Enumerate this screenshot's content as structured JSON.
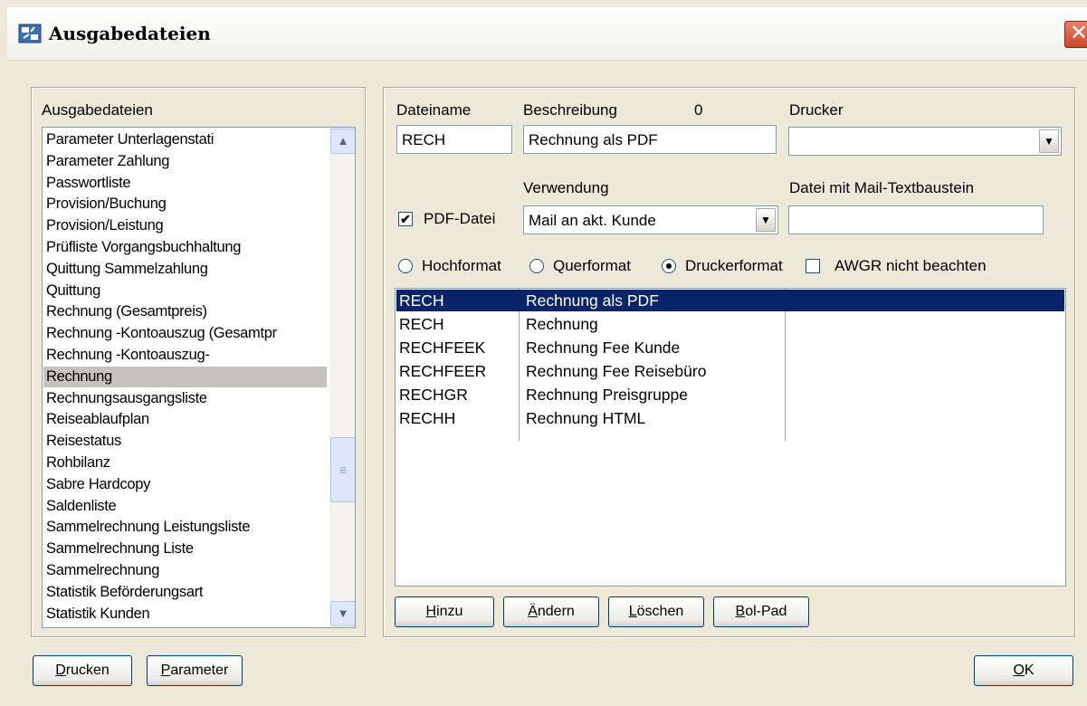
{
  "window": {
    "title": "Ausgabedateien",
    "close_glyph": "✕"
  },
  "left": {
    "label": "Ausgabedateien",
    "items": [
      "Parameter Unterlagenstati",
      "Parameter Zahlung",
      "Passwortliste",
      "Provision/Buchung",
      "Provision/Leistung",
      "Prüfliste Vorgangsbuchhaltung",
      "Quittung Sammelzahlung",
      "Quittung",
      "Rechnung (Gesamtpreis)",
      "Rechnung -Kontoauszug (Gesamtpr",
      "Rechnung -Kontoauszug-",
      "Rechnung",
      "Rechnungsausgangsliste",
      "Reiseablaufplan",
      "Reisestatus",
      "Rohbilanz",
      "Sabre Hardcopy",
      "Saldenliste",
      "Sammelrechnung Leistungsliste",
      "Sammelrechnung Liste",
      "Sammelrechnung",
      "Statistik Beförderungsart",
      "Statistik Kunden"
    ],
    "selected_index": 11
  },
  "form": {
    "dateiname_label": "Dateiname",
    "dateiname_value": "RECH",
    "beschreibung_label": "Beschreibung",
    "beschreibung_count": "0",
    "beschreibung_value": "Rechnung als PDF",
    "drucker_label": "Drucker",
    "drucker_value": "",
    "verwendung_label": "Verwendung",
    "verwendung_value": "Mail an akt. Kunde",
    "mail_label": "Datei mit Mail-Textbaustein",
    "mail_value": "",
    "pdf_label": "PDF-Datei",
    "pdf_checked": true,
    "hochformat": "Hochformat",
    "querformat": "Querformat",
    "druckerformat": "Druckerformat",
    "awgr_label": "AWGR nicht beachten"
  },
  "grid": {
    "rows": [
      {
        "code": "RECH",
        "desc": "Rechnung als PDF",
        "selected": true
      },
      {
        "code": "RECH",
        "desc": "Rechnung"
      },
      {
        "code": "RECHFEEK",
        "desc": "Rechnung Fee Kunde"
      },
      {
        "code": "RECHFEER",
        "desc": "Rechnung Fee Reisebüro"
      },
      {
        "code": "RECHGR",
        "desc": "Rechnung Preisgruppe"
      },
      {
        "code": "RECHH",
        "desc": "Rechnung HTML"
      }
    ]
  },
  "buttons": {
    "hinzu_u": "H",
    "hinzu_rest": "inzu",
    "aendern_u": "Ä",
    "aendern_rest": "ndern",
    "loeschen_u": "L",
    "loeschen_rest": "öschen",
    "bolpad_u": "B",
    "bolpad_rest": "ol-Pad",
    "drucken_u": "D",
    "drucken_rest": "rucken",
    "parameter_u": "P",
    "parameter_rest": "arameter",
    "ok_u": "O",
    "ok_rest": "K"
  }
}
